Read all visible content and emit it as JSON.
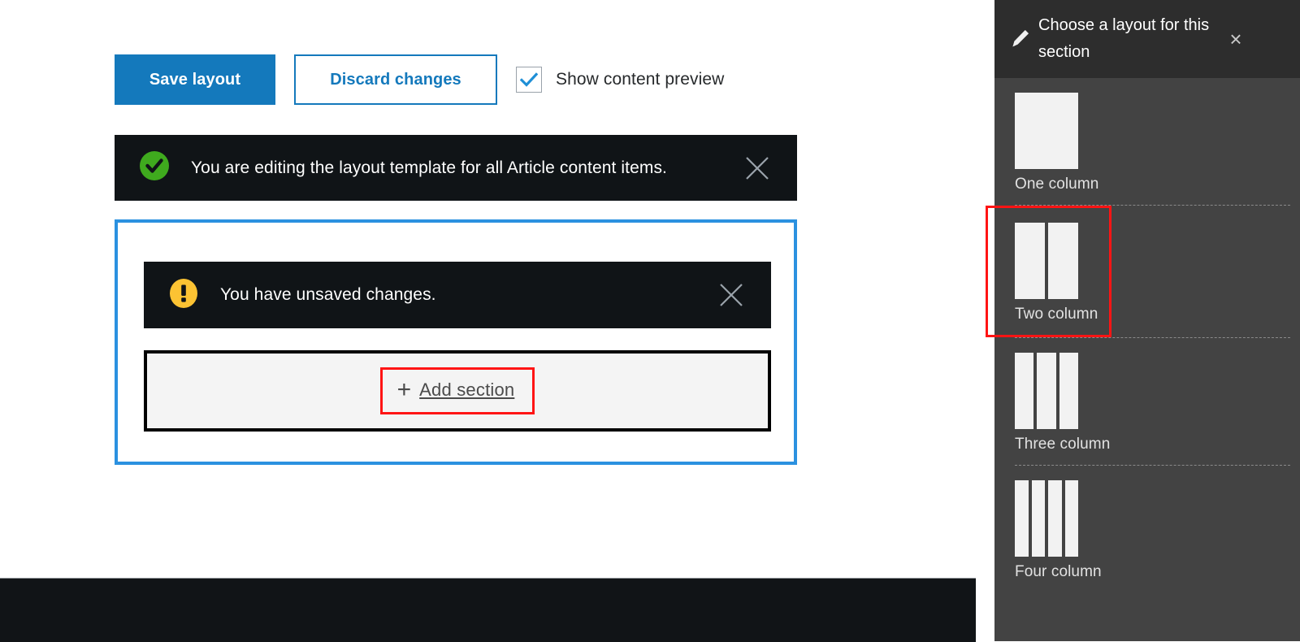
{
  "toolbar": {
    "save_label": "Save layout",
    "discard_label": "Discard changes",
    "preview_label": "Show content preview",
    "preview_checked": true,
    "save_bg": "#1479bc",
    "accent_blue": "#1479bc"
  },
  "banners": {
    "editing": {
      "icon": "success-check-icon",
      "icon_color": "#3faa1e",
      "text": "You are editing the layout template for all Article content items.",
      "close_icon": "close-icon"
    },
    "unsaved": {
      "icon": "warning-exclamation-icon",
      "icon_color": "#fcc333",
      "text": "You have unsaved changes.",
      "close_icon": "close-icon"
    }
  },
  "section": {
    "outline_color": "#2b91e0",
    "add_section": {
      "plus_icon": "plus-icon",
      "plus_glyph": "+",
      "label": "Add section",
      "highlight_color": "#ff1414"
    }
  },
  "panel": {
    "pencil_icon": "pencil-icon",
    "title": "Choose a layout for this section",
    "close_icon": "close-icon",
    "close_glyph": "×",
    "highlight_color": "#ff1414",
    "options": [
      {
        "label": "One column",
        "columns": 1,
        "highlighted": false
      },
      {
        "label": "Two column",
        "columns": 2,
        "highlighted": true
      },
      {
        "label": "Three column",
        "columns": 3,
        "highlighted": false
      },
      {
        "label": "Four column",
        "columns": 4,
        "highlighted": false
      }
    ]
  }
}
